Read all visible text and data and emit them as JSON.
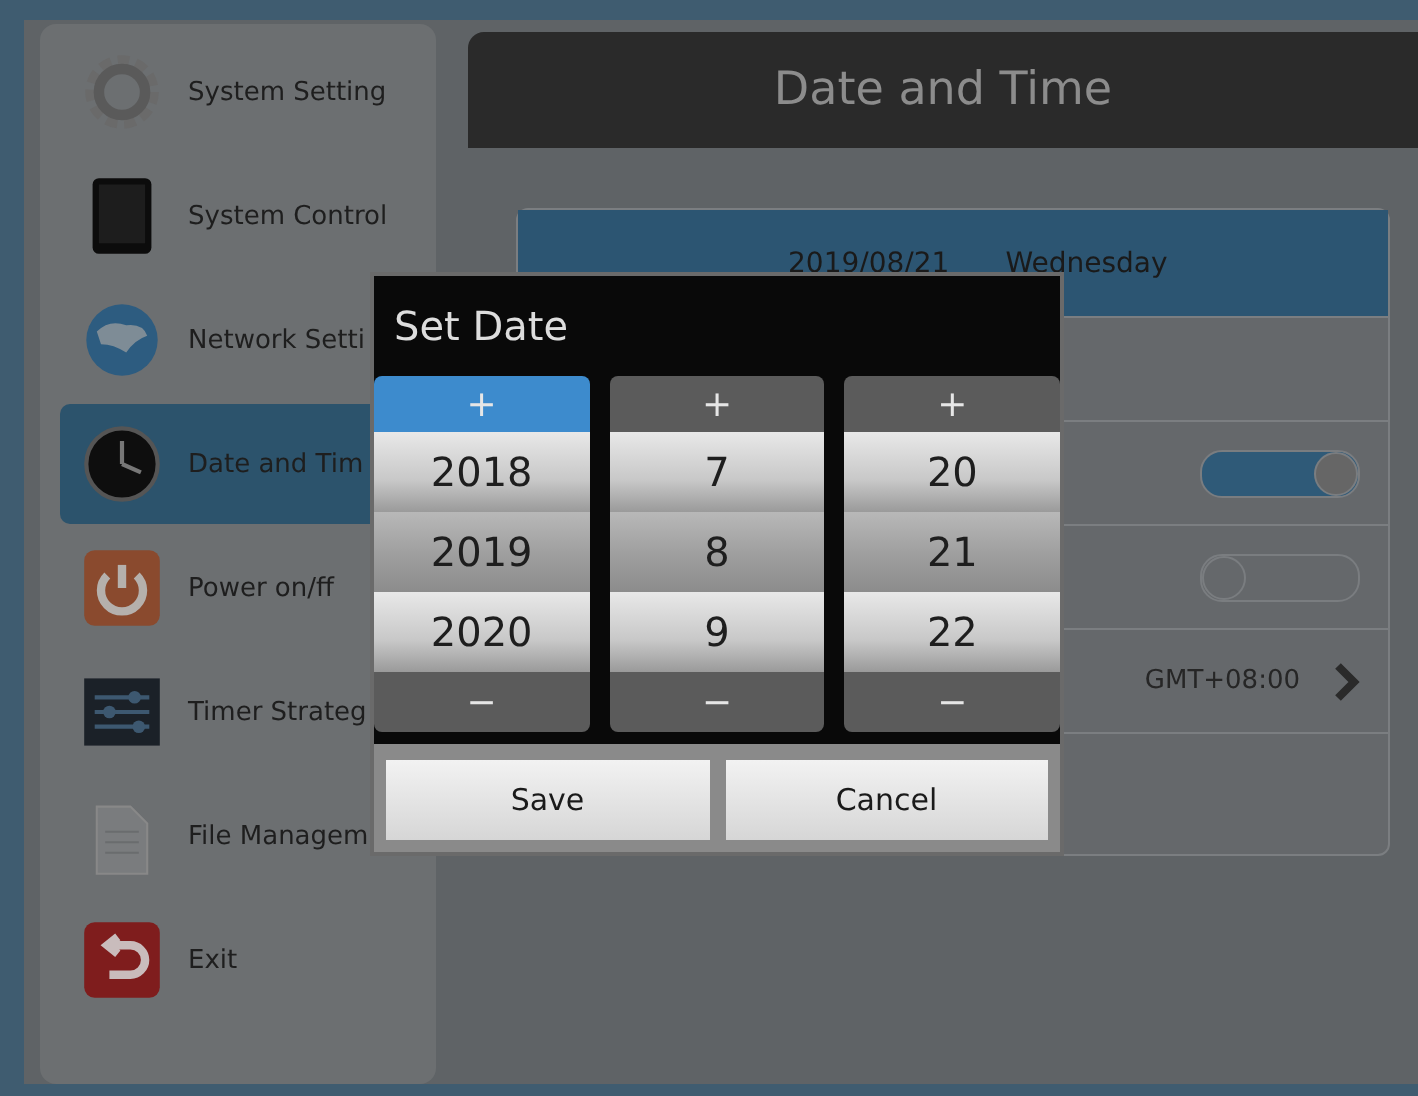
{
  "sidebar": {
    "items": [
      {
        "label": "System Setting",
        "kind": "gear",
        "selected": false
      },
      {
        "label": "System Control",
        "kind": "tablet",
        "selected": false
      },
      {
        "label": "Network Setti",
        "kind": "globe",
        "selected": false
      },
      {
        "label": "Date and Tim",
        "kind": "clock",
        "selected": true
      },
      {
        "label": "Power on/ff",
        "kind": "power",
        "selected": false
      },
      {
        "label": "Timer Strateg",
        "kind": "sliders",
        "selected": false
      },
      {
        "label": "File Managem",
        "kind": "file",
        "selected": false
      },
      {
        "label": "Exit",
        "kind": "exit",
        "selected": false
      }
    ]
  },
  "header": {
    "title": "Date and Time"
  },
  "settings": [
    {
      "kind": "date",
      "date": "2019/08/21",
      "weekday": "Wednesday",
      "selected": true
    },
    {
      "kind": "blank",
      "selected": false
    },
    {
      "kind": "toggle",
      "on": true,
      "selected": false
    },
    {
      "kind": "toggle",
      "on": false,
      "selected": false
    },
    {
      "kind": "timezone",
      "value": "GMT+08:00",
      "selected": false
    },
    {
      "kind": "blank",
      "selected": false
    }
  ],
  "dialog": {
    "title": "Set Date",
    "columns": [
      {
        "plus": "+",
        "minus": "−",
        "values": [
          "2018",
          "2019",
          "2020"
        ],
        "selected": true
      },
      {
        "plus": "+",
        "minus": "−",
        "values": [
          "7",
          "8",
          "9"
        ],
        "selected": false
      },
      {
        "plus": "+",
        "minus": "−",
        "values": [
          "20",
          "21",
          "22"
        ],
        "selected": false
      }
    ],
    "buttons": [
      "Save",
      "Cancel"
    ]
  }
}
